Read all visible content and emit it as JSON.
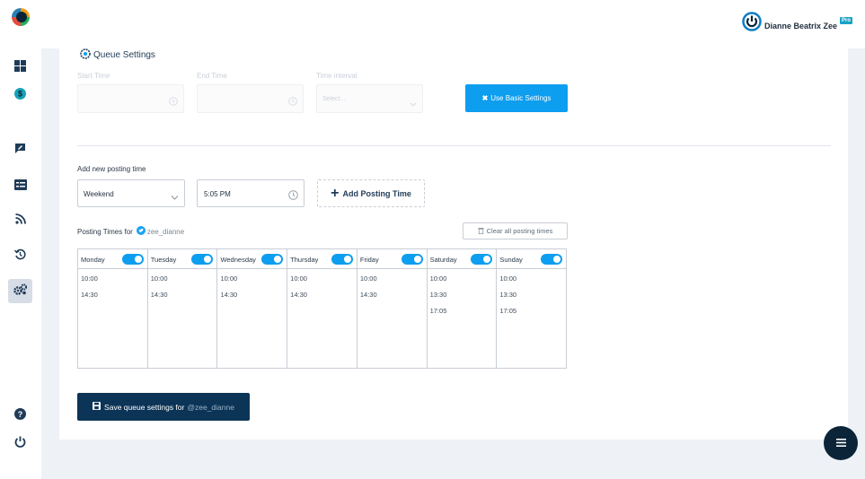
{
  "sidebar": {
    "logo": "brand-logo",
    "items": [
      {
        "icon": "dashboard-icon"
      },
      {
        "icon": "dollar-icon"
      },
      {
        "icon": "compose-icon"
      },
      {
        "icon": "list-icon"
      },
      {
        "icon": "rss-icon"
      },
      {
        "icon": "history-icon"
      },
      {
        "icon": "settings-icon",
        "active": true
      },
      {
        "icon": "help-icon"
      },
      {
        "icon": "power-icon"
      }
    ]
  },
  "header": {
    "user_name": "Dianne Beatrix Zee",
    "badge": "Pro"
  },
  "queue": {
    "title": "Queue Settings",
    "start_time_label": "Start Time",
    "end_time_label": "End Time",
    "interval_label": "Time interval",
    "interval_placeholder": "Select...",
    "basic_button": "Use Basic Settings"
  },
  "add_time": {
    "label": "Add new posting time",
    "day_value": "Weekend",
    "time_value": "5:05 PM",
    "button": "Add Posting Time"
  },
  "posting": {
    "label": "Posting Times for",
    "handle": "zee_dianne",
    "clear_button": "Clear all posting times",
    "days": [
      {
        "name": "Monday",
        "enabled": true,
        "times": [
          "10:00",
          "14:30"
        ]
      },
      {
        "name": "Tuesday",
        "enabled": true,
        "times": [
          "10:00",
          "14:30"
        ]
      },
      {
        "name": "Wednesday",
        "enabled": true,
        "times": [
          "10:00",
          "14:30"
        ]
      },
      {
        "name": "Thursday",
        "enabled": true,
        "times": [
          "10:00",
          "14:30"
        ]
      },
      {
        "name": "Friday",
        "enabled": true,
        "times": [
          "10:00",
          "14:30"
        ]
      },
      {
        "name": "Saturday",
        "enabled": true,
        "times": [
          "10:00",
          "13:30",
          "17:05"
        ]
      },
      {
        "name": "Sunday",
        "enabled": true,
        "times": [
          "10:00",
          "13:30",
          "17:05"
        ]
      }
    ]
  },
  "save": {
    "label": "Save queue settings for",
    "handle": "@zee_dianne"
  },
  "colors": {
    "accent": "#0d9ef0",
    "primary_dark": "#0b3457",
    "fab": "#0b2438"
  }
}
